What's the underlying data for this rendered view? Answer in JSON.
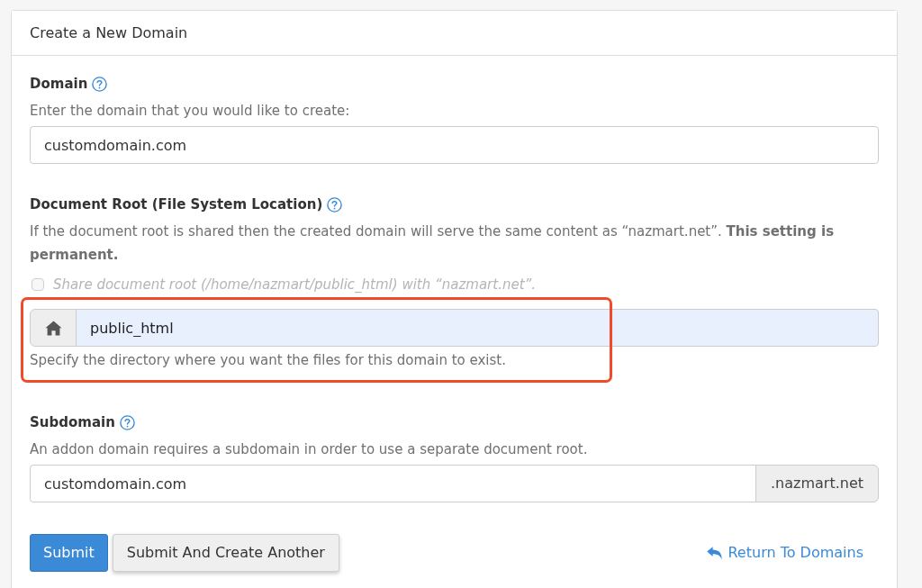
{
  "panel": {
    "title": "Create a New Domain"
  },
  "fields": [
    {
      "kind": "text",
      "label": "Domain",
      "description": "Enter the domain that you would like to create:",
      "value": "customdomain.com"
    },
    {
      "kind": "directory",
      "label": "Document Root (File System Location)",
      "description": "If the document root is shared then the created domain will serve the same content as “nazmart.net”. **This setting is permanent.**",
      "checkbox": {
        "label": "Share document root (/home/nazmart/public_html) with “nazmart.net”.",
        "checked": false,
        "disabled": true
      },
      "value": "public_html",
      "autofilled": true,
      "note": "Specify the directory where you want the files for this domain to exist.",
      "highlighted": true
    },
    {
      "kind": "suffixed",
      "label": "Subdomain",
      "description": "An addon domain requires a subdomain in order to use a separate document root.",
      "value": "customdomain.com",
      "suffix": ".nazmart.net"
    }
  ],
  "buttons": [
    {
      "label": "Submit",
      "kind": "primary"
    },
    {
      "label": "Submit And Create Another",
      "kind": "secondary"
    }
  ],
  "return_link": {
    "label": "Return To Domains"
  }
}
